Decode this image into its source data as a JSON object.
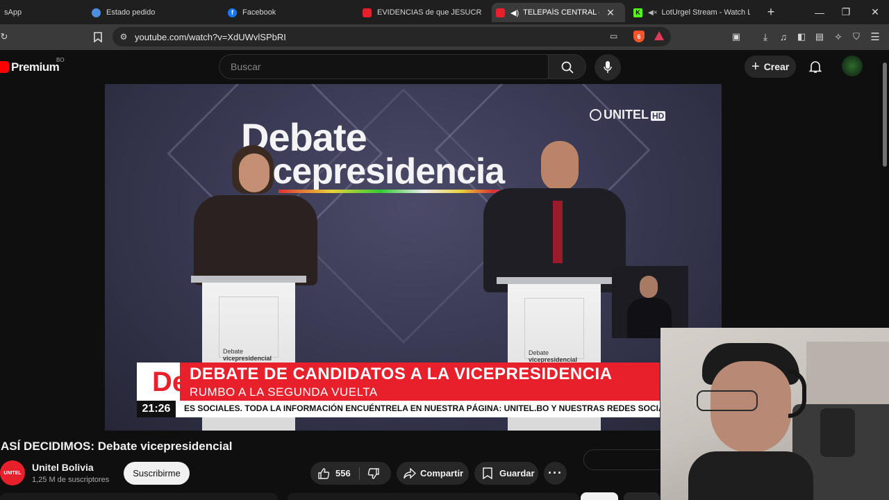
{
  "browser": {
    "tabs": [
      {
        "title": "sApp",
        "favicon": "whatsapp-icon"
      },
      {
        "title": "Estado pedido",
        "favicon": "globe-icon"
      },
      {
        "title": "Facebook",
        "favicon": "facebook-icon"
      },
      {
        "title": "EVIDENCIAS de que JESUCRISTO",
        "favicon": "youtube-icon"
      },
      {
        "title": "TELEPAÍS CENTRAL - You",
        "favicon": "youtube-icon",
        "active": true
      },
      {
        "title": "LotUrgel Stream - Watch Live",
        "favicon": "kick-icon"
      }
    ],
    "new_tab": "+",
    "url": "youtube.com/watch?v=XdUWvlSPbRI",
    "shield_count": "6"
  },
  "youtube": {
    "logo_text": "Premium",
    "region": "BO",
    "search_placeholder": "Buscar",
    "create_label": "Crear",
    "video": {
      "overlay_title_1": "Debate",
      "overlay_title_2": "vicepresidencia",
      "channel_logo": "UNITEL",
      "channel_logo_hd": "HD",
      "podium_label_1": "Debate",
      "podium_label_2": "vicepresidencial",
      "banner_logo": "De",
      "banner_headline": "DEBATE DE CANDIDATOS A LA VICEPRESIDENCIA",
      "banner_subhead": "RUMBO A LA SEGUNDA VUELTA",
      "ticker_time": "21:26",
      "ticker_text": "ES SOCIALES.     TODA LA INFORMACIÓN ENCUÉNTRELA EN NUESTRA PÁGINA: UNITEL.BO Y NUESTRAS REDES SOCIALES."
    },
    "title": "ASÍ DECIDIMOS: Debate vicepresidencial",
    "channel": {
      "name": "Unitel Bolivia",
      "subscribers": "1,25 M de suscriptores",
      "avatar_text": "UNITEL"
    },
    "subscribe_label": "Suscribirme",
    "likes": "556",
    "share_label": "Compartir",
    "save_label": "Guardar"
  },
  "colors": {
    "accent": "#e8202b",
    "background": "#0f0f0f"
  }
}
